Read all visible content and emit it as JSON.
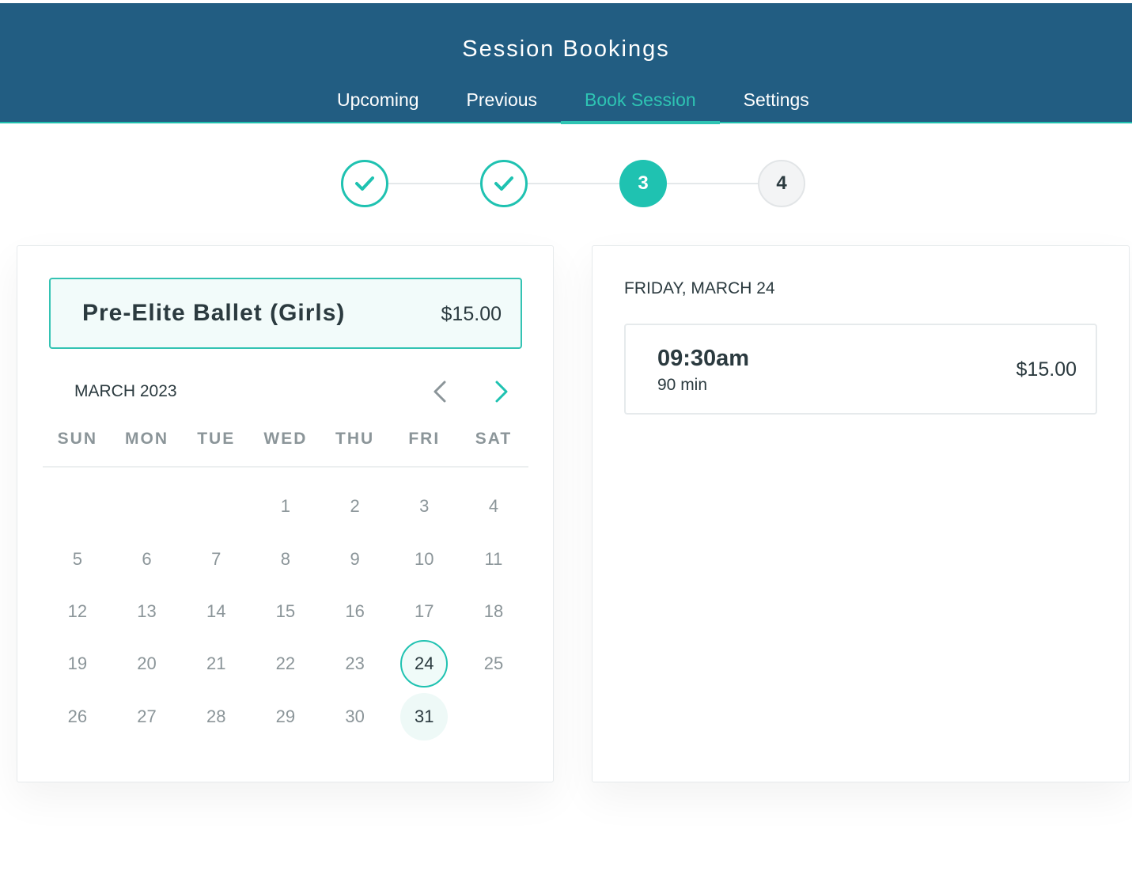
{
  "header": {
    "title": "Session Bookings",
    "tabs": [
      {
        "label": "Upcoming",
        "active": false
      },
      {
        "label": "Previous",
        "active": false
      },
      {
        "label": "Book Session",
        "active": true
      },
      {
        "label": "Settings",
        "active": false
      }
    ]
  },
  "stepper": {
    "steps": [
      {
        "label": "1",
        "state": "done",
        "icon": "check-icon"
      },
      {
        "label": "2",
        "state": "done",
        "icon": "check-icon"
      },
      {
        "label": "3",
        "state": "current"
      },
      {
        "label": "4",
        "state": "pending"
      }
    ]
  },
  "service": {
    "name": "Pre-Elite Ballet (Girls)",
    "price": "$15.00"
  },
  "calendar": {
    "month_label": "MARCH 2023",
    "prev_icon": "chevron-left-icon",
    "next_icon": "chevron-right-icon",
    "weekdays": [
      "SUN",
      "MON",
      "TUE",
      "WED",
      "THU",
      "FRI",
      "SAT"
    ],
    "leading_blanks": 3,
    "days": [
      "1",
      "2",
      "3",
      "4",
      "5",
      "6",
      "7",
      "8",
      "9",
      "10",
      "11",
      "12",
      "13",
      "14",
      "15",
      "16",
      "17",
      "18",
      "19",
      "20",
      "21",
      "22",
      "23",
      "24",
      "25",
      "26",
      "27",
      "28",
      "29",
      "30",
      "31"
    ],
    "selected_day": "24",
    "available_days": [
      "31"
    ]
  },
  "schedule": {
    "date_heading": "FRIDAY, MARCH 24",
    "slots": [
      {
        "time": "09:30am",
        "duration": "90 min",
        "price": "$15.00"
      }
    ]
  },
  "colors": {
    "header_bg": "#225d82",
    "accent": "#1fc2b1"
  }
}
